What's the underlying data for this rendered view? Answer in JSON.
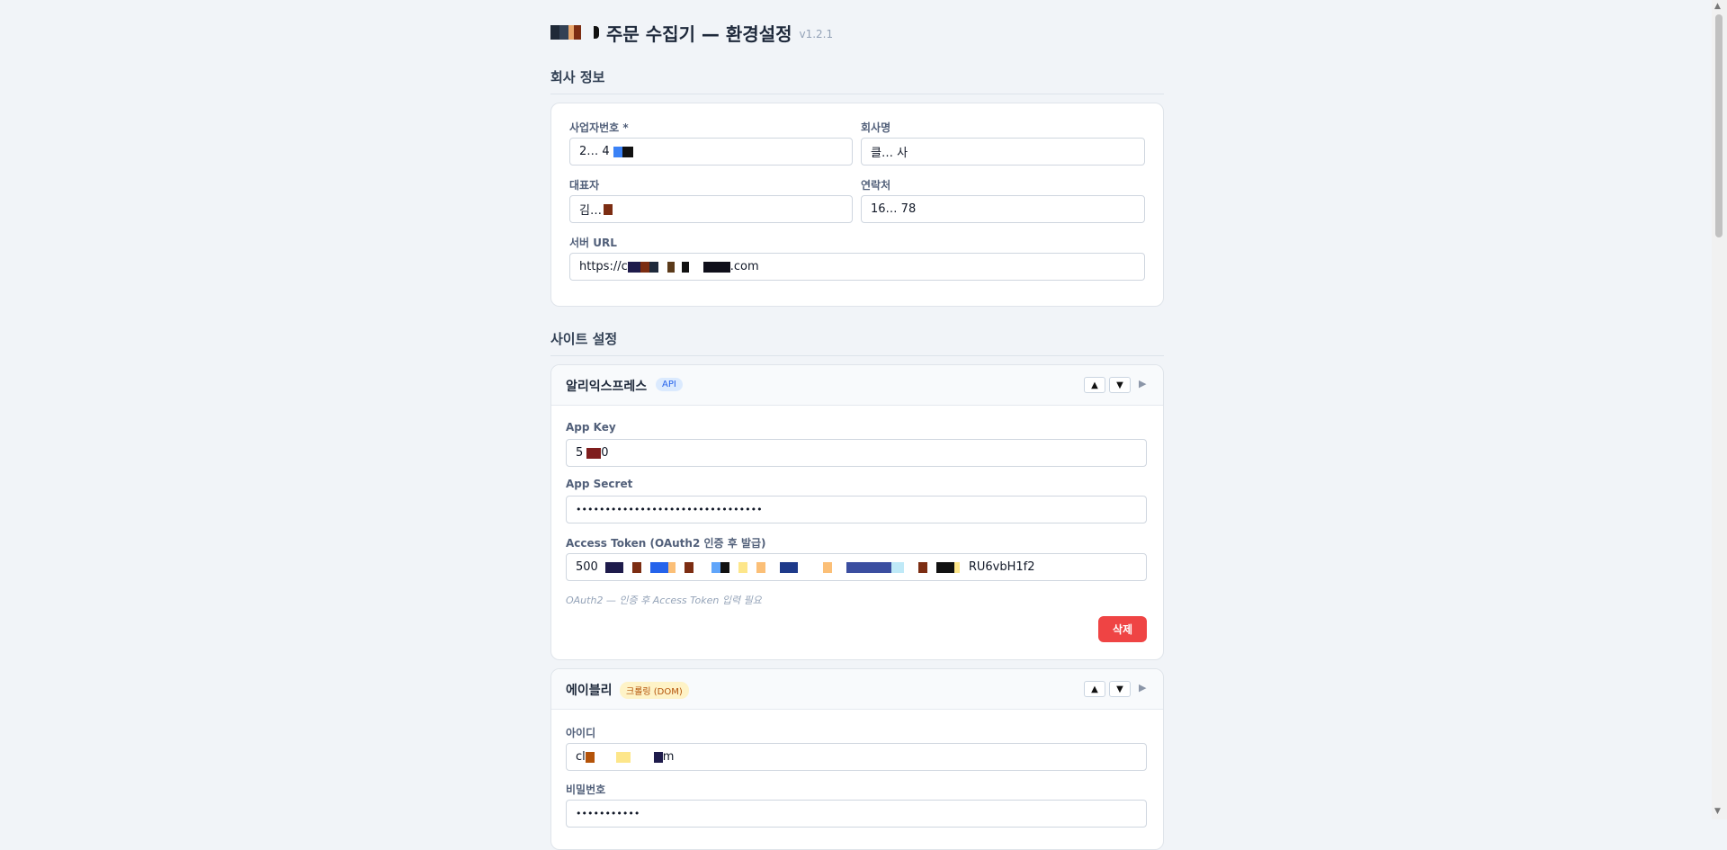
{
  "header": {
    "title": "주문 수집기 — 환경설정",
    "version": "v1.2.1"
  },
  "sections": {
    "company": "회사 정보",
    "sites": "사이트 설정"
  },
  "company": {
    "biz_no_label": "사업자번호 *",
    "biz_no_value": "2… 4",
    "company_label": "회사명",
    "company_value": "클… 사",
    "ceo_label": "대표자",
    "ceo_value": "김…",
    "contact_label": "연락처",
    "contact_value": "16… 78",
    "server_label": "서버 URL",
    "server_value_prefix": "https://c",
    "server_value_suffix": ".com"
  },
  "aliexpress": {
    "name": "알리익스프레스",
    "badge": "API",
    "app_key_label": "App Key",
    "app_key_value": "5",
    "app_key_suffix": "0",
    "app_secret_label": "App Secret",
    "app_secret_value": "••••••••••••••••••••••••••••••••",
    "token_label": "Access Token (OAuth2 인증 후 발급)",
    "token_prefix": "500",
    "token_suffix": "RU6vbH1f2",
    "hint": "OAuth2 — 인증 후 Access Token 입력 필요",
    "delete_label": "삭제",
    "up": "▲",
    "down": "▼",
    "expand": "▶"
  },
  "ably": {
    "name": "에이블리",
    "badge": "크롤링 (DOM)",
    "id_label": "아이디",
    "id_prefix": "cl",
    "id_suffix": "m",
    "pw_label": "비밀번호",
    "pw_value": "•••••••••••",
    "up": "▲",
    "down": "▼",
    "expand": "▶"
  },
  "colors": {
    "accent": "#2563eb",
    "danger": "#ef4444",
    "background": "#f1f4f8"
  }
}
